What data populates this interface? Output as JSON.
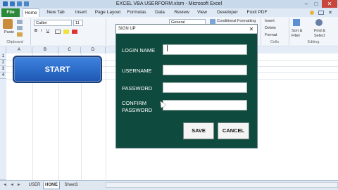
{
  "window": {
    "title": "EXCEL VBA USERFORM.xlsm - Microsoft Excel",
    "minimize": "–",
    "maximize": "□",
    "close": "✕"
  },
  "ribbon": {
    "tabs": [
      "File",
      "Home",
      "New Tab",
      "Insert",
      "Page Layout",
      "Formulas",
      "Data",
      "Review",
      "View",
      "Developer",
      "Foxit PDF"
    ],
    "clipboard": {
      "paste": "Paste",
      "label": "Clipboard"
    },
    "font": {
      "name": "Calibri",
      "size": "11",
      "bold": "B",
      "italic": "I",
      "underline": "U"
    },
    "number": {
      "format": "General"
    },
    "styles": {
      "conditional": "Conditional Formatting"
    },
    "cells": {
      "insert": "Insert",
      "delete": "Delete",
      "format": "Format",
      "label": "Cells"
    },
    "editing": {
      "sort": "Sort &",
      "sort2": "Filter",
      "find": "Find &",
      "find2": "Select",
      "label": "Editing"
    }
  },
  "grid": {
    "columns": [
      "A",
      "B",
      "C",
      "D"
    ],
    "rows": [
      "1",
      "2",
      "3",
      "4"
    ],
    "start_button": "START"
  },
  "sheet_tabs": [
    "USER",
    "HOME",
    "Sheet3"
  ],
  "dialog": {
    "title": "SIGN UP",
    "close": "✕",
    "labels": {
      "login": "LOGIN NAME",
      "username": "USERNAME",
      "password": "PASSWORD",
      "confirm_1": "CONFIRM",
      "confirm_2": "PASSWORD"
    },
    "save": "SAVE",
    "cancel": "CANCEL"
  }
}
